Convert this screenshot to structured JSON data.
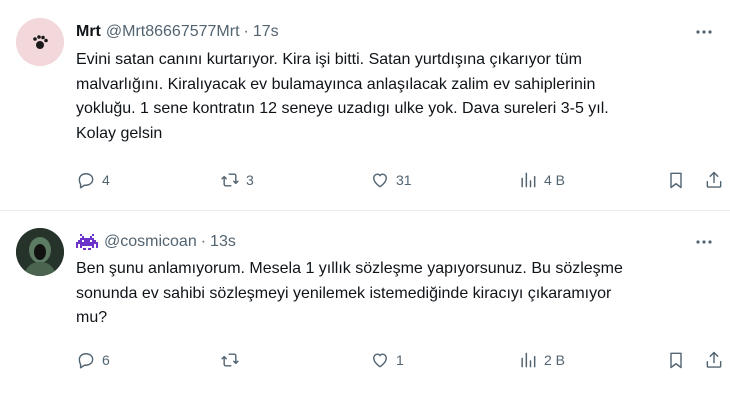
{
  "tweets": [
    {
      "name": "Mrt",
      "handle": "@Mrt86667577Mrt",
      "separator": "·",
      "time": "17s",
      "text": "Evini satan canını kurtarıyor. Kira işi bitti. Satan yurtdışına çıkarıyor tüm\nmalvarlığını. Kiralıyacak ev bulamayınca anlaşılacak zalim ev sahiplerinin\nyokluğu. 1 sene kontratın 12 seneye uzadıgı ulke yok. Dava sureleri 3-5 yıl.\nKolay gelsin",
      "replies": "4",
      "retweets": "3",
      "likes": "31",
      "views": "4 B"
    },
    {
      "name": "",
      "handle": "@cosmicoan",
      "separator": "·",
      "time": "13s",
      "text": "Ben şunu anlamıyorum. Mesela 1 yıllık sözleşme yapıyorsunuz. Bu sözleşme\nsonunda ev sahibi sözleşmeyi yenilemek istemediğinde kiracıyı çıkaramıyor\nmu?",
      "replies": "6",
      "retweets": "",
      "likes": "1",
      "views": "2 B"
    }
  ],
  "icons": {
    "more": "more-icon",
    "reply": "reply-icon",
    "retweet": "retweet-icon",
    "like": "heart-icon",
    "views": "views-icon",
    "bookmark": "bookmark-icon",
    "share": "share-icon",
    "name_emoji": "space-invader-emoji"
  },
  "colors": {
    "text": "#0f1419",
    "secondary": "#536471",
    "divider": "#e6ecf0",
    "emoji": "#6b33c9"
  }
}
